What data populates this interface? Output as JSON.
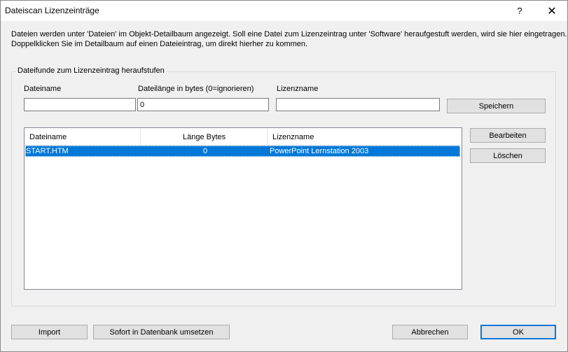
{
  "window": {
    "title": "Dateiscan Lizenzeinträge",
    "help_label": "?",
    "close_label": "✕"
  },
  "description": {
    "line1": "Dateien werden unter 'Dateien' im Objekt-Detailbaum angezeigt. Soll eine Datei zum Lizenzeintrag unter 'Software' heraufgestuft werden, wird sie hier eingetragen.",
    "line2": "Doppelklicken Sie im Detailbaum auf einen Dateieintrag, um direkt hierher zu kommen."
  },
  "group": {
    "label": "Dateifunde zum Lizenzeintrag heraufstufen",
    "filename_label": "Dateiname",
    "filename_value": "",
    "length_label": "Dateilänge in bytes (0=ignorieren)",
    "length_value": "0",
    "license_label": "Lizenzname",
    "license_value": "",
    "save_label": "Speichern",
    "edit_label": "Bearbeiten",
    "delete_label": "Löschen"
  },
  "table": {
    "columns": [
      "Dateiname",
      "Länge Bytes",
      "Lizenzname"
    ],
    "rows": [
      {
        "filename": "START.HTM",
        "length": "0",
        "license": "PowerPoint Lernstation 2003",
        "selected": true
      }
    ]
  },
  "footer": {
    "import_label": "Import",
    "apply_label": "Sofort in Datenbank umsetzen",
    "cancel_label": "Abbrechen",
    "ok_label": "OK"
  },
  "colors": {
    "selection": "#0078d7",
    "default_button_border": "#0078d7"
  }
}
